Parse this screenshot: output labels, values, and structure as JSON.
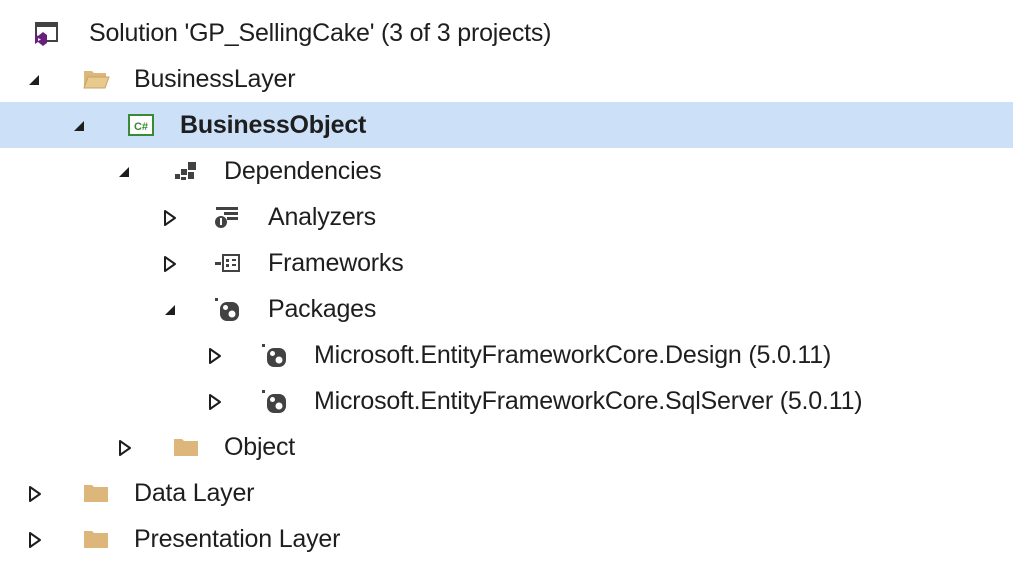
{
  "solution_explorer": {
    "solution": {
      "label": "Solution 'GP_SellingCake' (3 of 3 projects)"
    },
    "business_layer": {
      "label": "BusinessLayer",
      "business_object": {
        "label": "BusinessObject",
        "icon_text": "C#",
        "dependencies": {
          "label": "Dependencies",
          "analyzers": {
            "label": "Analyzers"
          },
          "frameworks": {
            "label": "Frameworks"
          },
          "packages": {
            "label": "Packages",
            "items": [
              {
                "label": "Microsoft.EntityFrameworkCore.Design (5.0.11)"
              },
              {
                "label": "Microsoft.EntityFrameworkCore.SqlServer (5.0.11)"
              }
            ]
          }
        },
        "object_folder": {
          "label": "Object"
        }
      }
    },
    "data_layer": {
      "label": "Data Layer"
    },
    "presentation_layer": {
      "label": "Presentation Layer"
    },
    "colors": {
      "selection": "#cce0f8",
      "folder": "#dcb67a",
      "csharp_green": "#388a34",
      "vs_purple": "#68217a"
    }
  }
}
